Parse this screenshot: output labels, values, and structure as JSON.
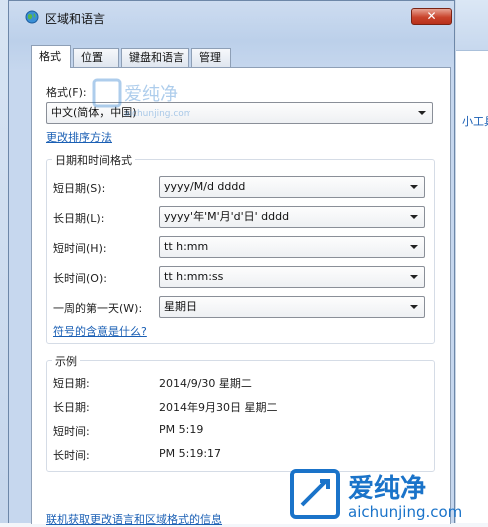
{
  "background": {
    "link_text": "小工具"
  },
  "dialog": {
    "title": "区域和语言",
    "close_glyph": "✕",
    "tabs": [
      {
        "label": "格式",
        "active": true
      },
      {
        "label": "位置",
        "active": false
      },
      {
        "label": "键盘和语言",
        "active": false
      },
      {
        "label": "管理",
        "active": false
      }
    ]
  },
  "format": {
    "label": "格式(F):",
    "value": "中文(简体，中国)",
    "sort_link": "更改排序方法"
  },
  "datetime": {
    "group_title": "日期和时间格式",
    "short_date_label": "短日期(S):",
    "short_date_value": "yyyy/M/d dddd",
    "long_date_label": "长日期(L):",
    "long_date_value": "yyyy'年'M'月'd'日' dddd",
    "short_time_label": "短时间(H):",
    "short_time_value": "tt h:mm",
    "long_time_label": "长时间(O):",
    "long_time_value": "tt h:mm:ss",
    "first_day_label": "一周的第一天(W):",
    "first_day_value": "星期日",
    "symbol_link": "符号的含意是什么?"
  },
  "examples": {
    "group_title": "示例",
    "short_date_label": "短日期:",
    "short_date_value": "2014/9/30 星期二",
    "long_date_label": "长日期:",
    "long_date_value": "2014年9月30日 星期二",
    "short_time_label": "短时间:",
    "short_time_value": "PM 5:19",
    "long_time_label": "长时间:",
    "long_time_value": "PM 5:19:17"
  },
  "footer_link": "联机获取更改语言和区域格式的信息",
  "watermark": {
    "brand": "爱纯净",
    "site": "aichunjing.com"
  },
  "colors": {
    "link": "#1a5fb4",
    "close_button": "#c9442c",
    "watermark": "#1a73c9"
  }
}
